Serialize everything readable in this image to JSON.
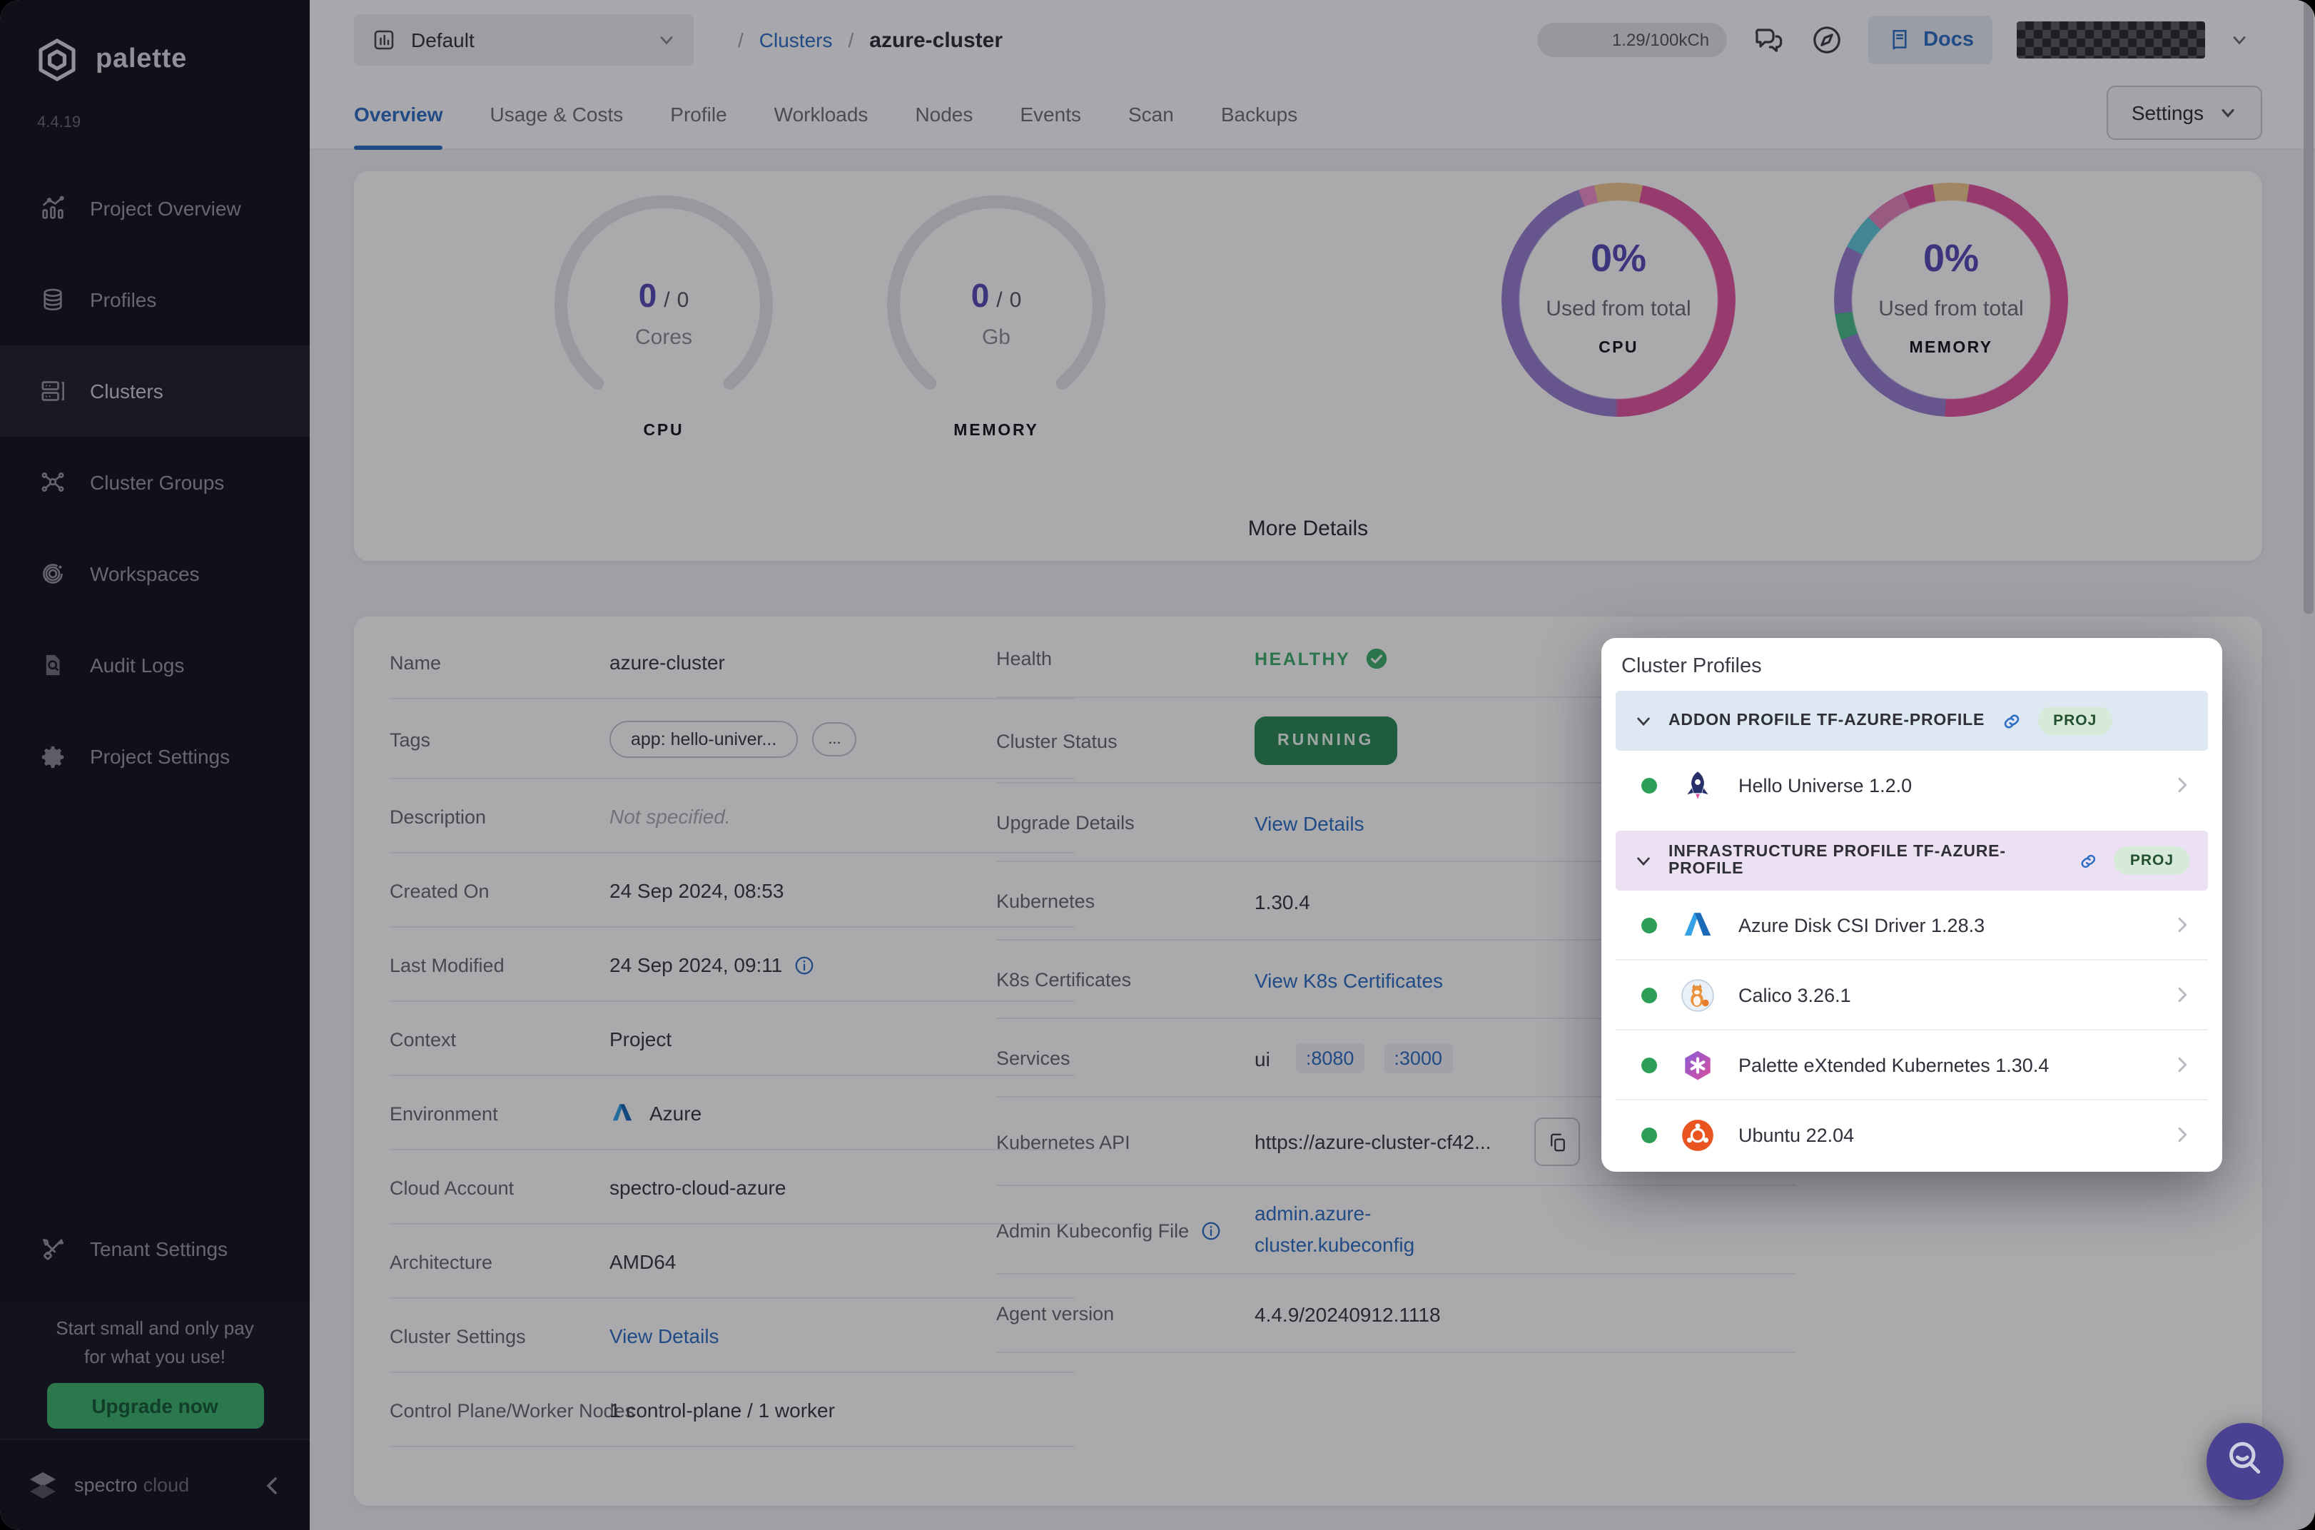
{
  "colors": {
    "sidebar_bg": "#16161f",
    "accent_blue": "#2f6fc2",
    "health_green": "#3fae6c",
    "status_green": "#2e8b57",
    "upgrade_green": "#3fb371",
    "metric_purple": "#5a4cb8",
    "donut_pink": "#e2569f",
    "donut_purple": "#9a7fd1",
    "donut_tan": "#f0c98f",
    "donut_teal": "#62c8d8",
    "donut_green": "#4cbe8c",
    "fab_indigo": "#4a4192"
  },
  "sidebar": {
    "logo_text": "palette",
    "version": "4.4.19",
    "items": [
      {
        "label": "Project Overview",
        "icon": "chart-icon",
        "active": false
      },
      {
        "label": "Profiles",
        "icon": "stack-icon",
        "active": false
      },
      {
        "label": "Clusters",
        "icon": "servers-icon",
        "active": true
      },
      {
        "label": "Cluster Groups",
        "icon": "network-icon",
        "active": false
      },
      {
        "label": "Workspaces",
        "icon": "orbit-icon",
        "active": false
      },
      {
        "label": "Audit Logs",
        "icon": "audit-icon",
        "active": false
      },
      {
        "label": "Project Settings",
        "icon": "gear-icon",
        "active": false
      }
    ],
    "tenant": {
      "label": "Tenant Settings",
      "icon": "tools-icon"
    },
    "promo": {
      "line1": "Start small and only pay",
      "line2": "for what you use!",
      "button": "Upgrade now"
    },
    "footer": {
      "brand_primary": "spectro",
      "brand_secondary": "cloud"
    }
  },
  "topbar": {
    "project_selector": {
      "label": "Default"
    },
    "breadcrumb": {
      "separator": "/",
      "section": "Clusters",
      "current": "azure-cluster"
    },
    "usage_badge": "1.29/100kCh",
    "docs_label": "Docs"
  },
  "tabs": {
    "items": [
      {
        "label": "Overview",
        "active": true
      },
      {
        "label": "Usage & Costs",
        "active": false
      },
      {
        "label": "Profile",
        "active": false
      },
      {
        "label": "Workloads",
        "active": false
      },
      {
        "label": "Nodes",
        "active": false
      },
      {
        "label": "Events",
        "active": false
      },
      {
        "label": "Scan",
        "active": false
      },
      {
        "label": "Backups",
        "active": false
      }
    ],
    "settings_label": "Settings"
  },
  "overview": {
    "gauges": [
      {
        "value": "0",
        "separator": "/",
        "total": "0",
        "unit": "Cores",
        "caption": "CPU"
      },
      {
        "value": "0",
        "separator": "/",
        "total": "0",
        "unit": "Gb",
        "caption": "MEMORY"
      }
    ],
    "donuts": [
      {
        "percent": "0%",
        "subtitle": "Used from total",
        "caption": "CPU"
      },
      {
        "percent": "0%",
        "subtitle": "Used from total",
        "caption": "MEMORY"
      }
    ],
    "more_details": "More Details"
  },
  "details": {
    "left": [
      {
        "label": "Name",
        "type": "text",
        "value": "azure-cluster"
      },
      {
        "label": "Tags",
        "type": "tags",
        "chips": [
          "app: hello-univer...",
          "..."
        ]
      },
      {
        "label": "Description",
        "type": "muted",
        "value": "Not specified."
      },
      {
        "label": "Created On",
        "type": "text",
        "value": "24 Sep 2024, 08:53"
      },
      {
        "label": "Last Modified",
        "type": "text-info",
        "value": "24 Sep 2024, 09:11"
      },
      {
        "label": "Context",
        "type": "text",
        "value": "Project"
      },
      {
        "label": "Environment",
        "type": "env",
        "value": "Azure"
      },
      {
        "label": "Cloud Account",
        "type": "text",
        "value": "spectro-cloud-azure"
      },
      {
        "label": "Architecture",
        "type": "text",
        "value": "AMD64"
      },
      {
        "label": "Cluster Settings",
        "type": "link",
        "value": "View Details"
      },
      {
        "label": "Control Plane/Worker Nodes",
        "type": "text",
        "value": "1 control-plane / 1 worker"
      }
    ],
    "right": [
      {
        "label": "Health",
        "type": "health",
        "value": "HEALTHY"
      },
      {
        "label": "Cluster Status",
        "type": "status",
        "value": "RUNNING"
      },
      {
        "label": "Upgrade Details",
        "type": "link",
        "value": "View Details"
      },
      {
        "label": "Kubernetes",
        "type": "text",
        "value": "1.30.4"
      },
      {
        "label": "K8s Certificates",
        "type": "link",
        "value": "View K8s Certificates"
      },
      {
        "label": "Services",
        "type": "services",
        "name": "ui",
        "ports": [
          ":8080",
          ":3000"
        ]
      },
      {
        "label": "Kubernetes API",
        "type": "api",
        "value": "https://azure-cluster-cf42..."
      },
      {
        "label": "Admin Kubeconfig File",
        "type": "kubeconfig",
        "label_info": true,
        "lines": [
          "admin.azure-",
          "cluster.kubeconfig"
        ]
      },
      {
        "label": "Agent version",
        "type": "text",
        "value": "4.4.9/20240912.1118"
      }
    ]
  },
  "popup": {
    "title": "Cluster Profiles",
    "sections": [
      {
        "header": "ADDON PROFILE TF-AZURE-PROFILE",
        "badge": "PROJ",
        "tone": "blue",
        "rows": [
          {
            "name": "Hello Universe 1.2.0",
            "icon": "hello-universe-icon"
          }
        ]
      },
      {
        "header": "INFRASTRUCTURE PROFILE TF-AZURE-PROFILE",
        "badge": "PROJ",
        "tone": "purple",
        "rows": [
          {
            "name": "Azure Disk CSI Driver 1.28.3",
            "icon": "azure-icon"
          },
          {
            "name": "Calico 3.26.1",
            "icon": "calico-icon"
          },
          {
            "name": "Palette eXtended Kubernetes 1.30.4",
            "icon": "pxk-icon"
          },
          {
            "name": "Ubuntu 22.04",
            "icon": "ubuntu-icon"
          }
        ]
      }
    ]
  }
}
